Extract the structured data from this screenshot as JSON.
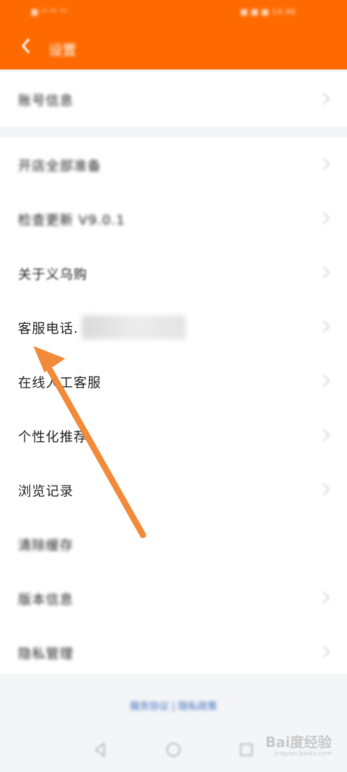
{
  "status_bar": {
    "left": "■ ᵃˡˡ ⁴ᴳ ⁴ᴳ",
    "right": "■ ■ ■ 14:46"
  },
  "app_bar": {
    "title": "设置"
  },
  "group1": {
    "items": [
      {
        "label": "账号信息"
      }
    ]
  },
  "group2": {
    "items": [
      {
        "label": "开店全部准备",
        "blurred": true
      },
      {
        "label": "检查更新 V9.0.1",
        "blurred": true
      },
      {
        "label": "关于义乌购"
      },
      {
        "label": "客服电话",
        "suffix": "."
      },
      {
        "label": "在线人工客服"
      },
      {
        "label": "个性化推荐"
      },
      {
        "label": "浏览记录"
      },
      {
        "label": "清除缓存",
        "blurred": true
      },
      {
        "label": "版本信息",
        "blurred": true
      },
      {
        "label": "隐私管理",
        "blurred": true
      }
    ]
  },
  "footer": {
    "links": "服务协议 | 隐私政策"
  },
  "watermark": {
    "brand": "Bai度经验",
    "url": "jingyan.baidu.com"
  },
  "colors": {
    "brand": "#ff6a00",
    "arrow": "#f28a3a"
  }
}
